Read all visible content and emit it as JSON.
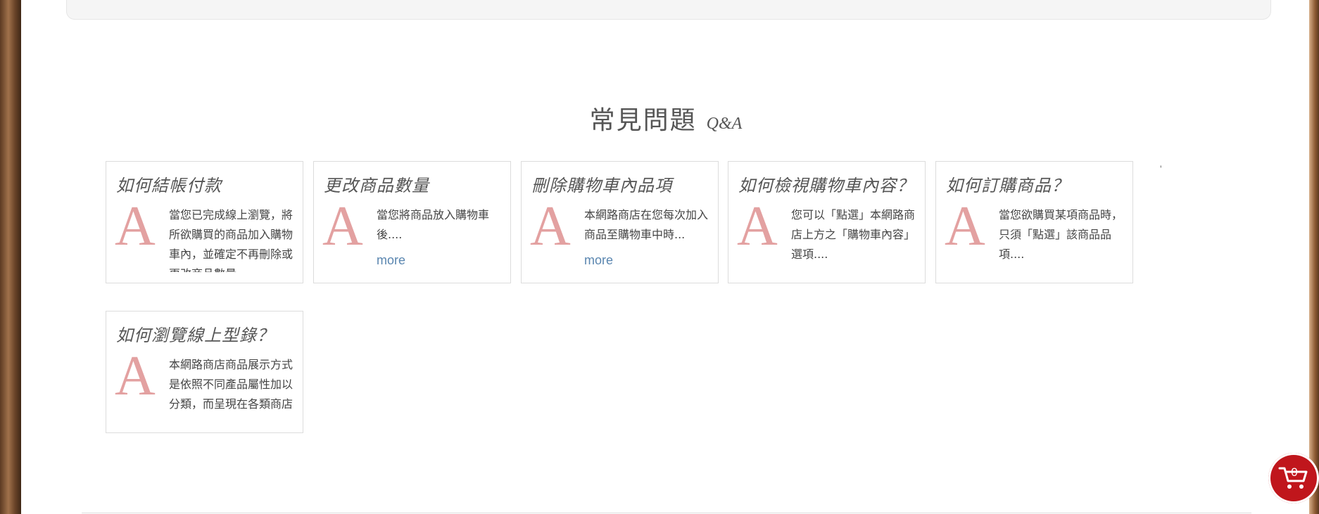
{
  "section": {
    "title_zh": "常見問題",
    "title_en": "Q&A"
  },
  "faq": [
    {
      "question": "如何結帳付款",
      "letter": "A",
      "answer": "當您已完成線上瀏覽，將所欲購買的商品加入購物車內，並確定不再刪除或更改商品數量",
      "more": ""
    },
    {
      "question": "更改商品數量",
      "letter": "A",
      "answer": "當您將商品放入購物車後....",
      "more": "more"
    },
    {
      "question": "刪除購物車內品項",
      "letter": "A",
      "answer": "本網路商店在您每次加入商品至購物車中時...",
      "more": "more"
    },
    {
      "question": "如何檢視購物車內容？",
      "letter": "A",
      "answer": "您可以「點選」本網路商店上方之「購物車內容」選項....",
      "more": ""
    },
    {
      "question": "如何訂購商品？",
      "letter": "A",
      "answer": "當您欲購買某項商品時，只須「點選」該商品品項....",
      "more": ""
    },
    {
      "question": "如何瀏覽線上型錄？",
      "letter": "A",
      "answer": "本網路商店商品展示方式是依照不同產品屬性加以分類，而呈現在各類商店",
      "more": ""
    }
  ],
  "stray_mark": "'",
  "cart": {
    "count": "0",
    "icon": "cart-icon",
    "color": "#c0161c"
  },
  "colors": {
    "accent_letter": "#e3a1a1",
    "link": "#5a86b0"
  }
}
